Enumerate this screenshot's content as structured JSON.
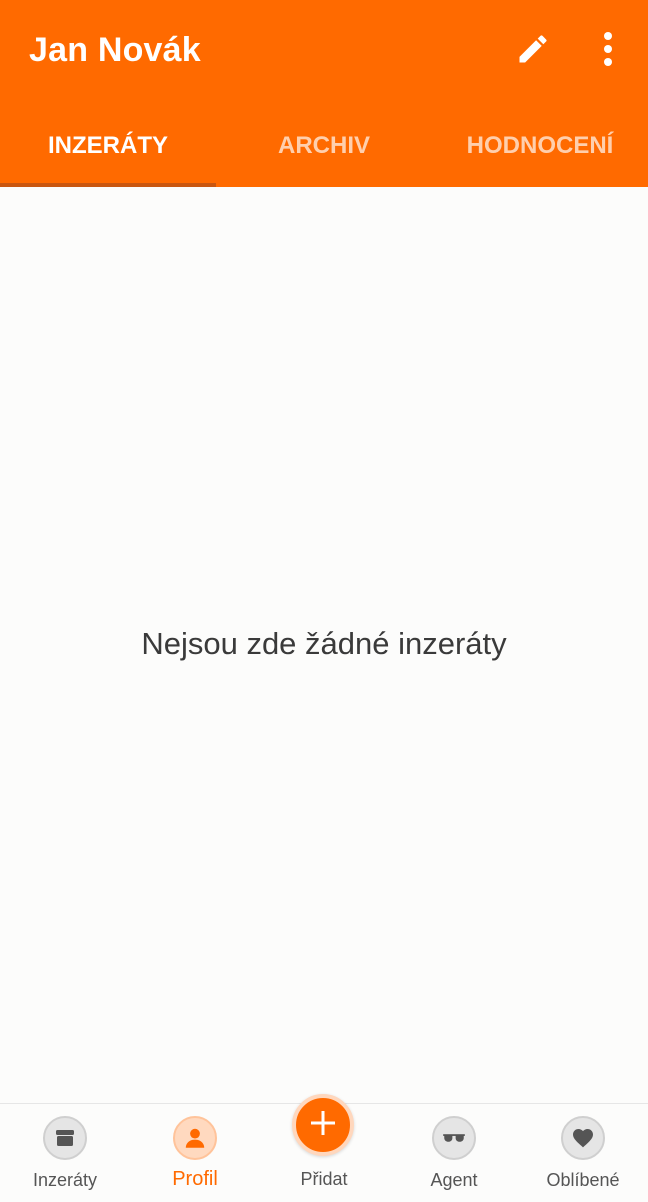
{
  "header": {
    "title": "Jan Novák",
    "edit_icon": "pencil-icon",
    "more_icon": "more-vertical-icon"
  },
  "tabs": [
    {
      "label": "INZERÁTY",
      "active": true
    },
    {
      "label": "ARCHIV",
      "active": false
    },
    {
      "label": "HODNOCENÍ",
      "active": false
    }
  ],
  "main": {
    "empty_message": "Nejsou zde žádné inzeráty"
  },
  "bottom_nav": {
    "items": [
      {
        "label": "Inzeráty",
        "icon": "box-icon",
        "active": false
      },
      {
        "label": "Profil",
        "icon": "person-icon",
        "active": true
      },
      {
        "label": "Přidat",
        "icon": "plus-icon",
        "active": false
      },
      {
        "label": "Agent",
        "icon": "sunglasses-icon",
        "active": false
      },
      {
        "label": "Oblíbené",
        "icon": "heart-icon",
        "active": false
      }
    ]
  },
  "colors": {
    "accent": "#ff6a00",
    "tab_indicator": "#c9560f",
    "background": "#fcfcfb"
  }
}
